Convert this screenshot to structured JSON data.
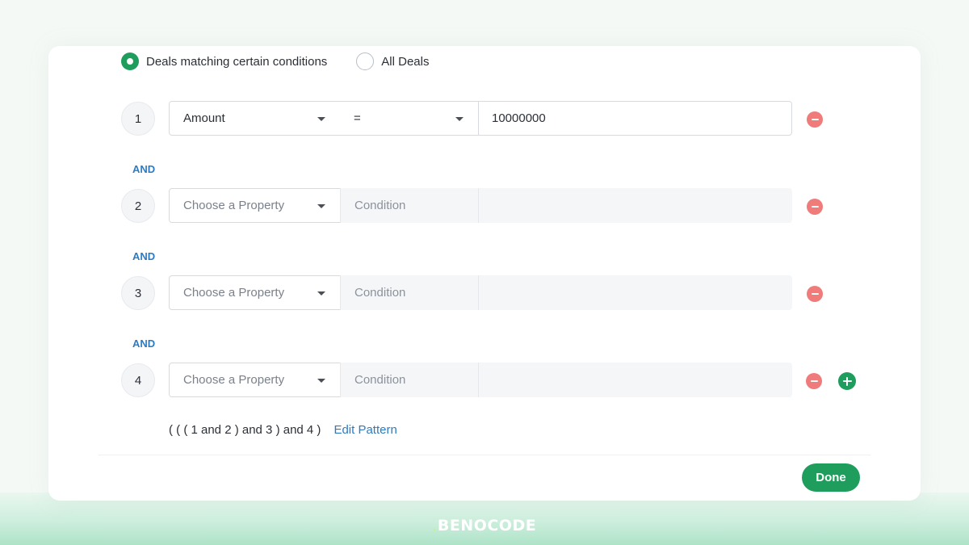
{
  "filter_mode": {
    "options": [
      {
        "label": "Deals matching certain conditions",
        "selected": true
      },
      {
        "label": "All Deals",
        "selected": false
      }
    ]
  },
  "conditions": [
    {
      "index": "1",
      "property": "Amount",
      "operator": "=",
      "value": "10000000",
      "filled": true
    },
    {
      "index": "2",
      "property": "Choose a Property",
      "operator": "Condition",
      "value": "",
      "filled": false
    },
    {
      "index": "3",
      "property": "Choose a Property",
      "operator": "Condition",
      "value": "",
      "filled": false
    },
    {
      "index": "4",
      "property": "Choose a Property",
      "operator": "Condition",
      "value": "",
      "filled": false
    }
  ],
  "connectors": [
    "AND",
    "AND",
    "AND"
  ],
  "pattern": {
    "text": "( ( ( 1 and 2 ) and 3 ) and 4 )",
    "edit_label": "Edit Pattern"
  },
  "footer": {
    "done_label": "Done"
  },
  "brand": {
    "mark": ".",
    "name": "BENOCODE"
  },
  "colors": {
    "accent_green": "#1f9d5c",
    "remove_red": "#ef7b7b",
    "link_blue": "#2b7bc4"
  },
  "icons": {
    "remove": "minus-circle-icon",
    "add": "plus-circle-icon",
    "dropdown": "caret-down-icon"
  }
}
